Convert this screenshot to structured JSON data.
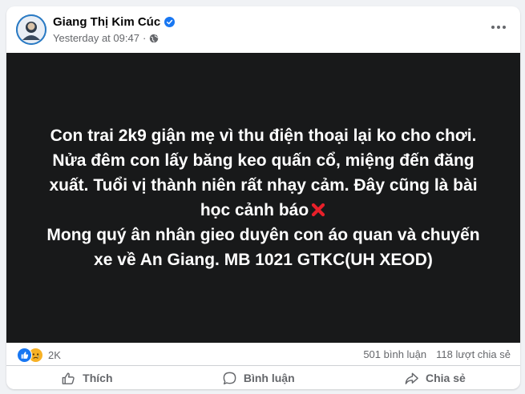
{
  "post": {
    "author": "Giang Thị Kim Cúc",
    "timestamp": "Yesterday at 09:47",
    "separator": "·",
    "privacy_icon": "globe-icon",
    "verified_icon": "verified-badge-icon",
    "more_icon": "more-options-icon"
  },
  "content": {
    "lines": [
      "Con trai 2k9 giận mẹ vì thu điện thoại lại ko cho chơi.",
      "Nửa đêm con lấy băng keo quấn cổ, miệng đến đăng",
      "xuất. Tuổi vị thành niên rất nhạy cảm. Đây cũng là bài",
      "học cảnh báo",
      "Mong quý ân nhân gieo duyên con áo quan và chuyến",
      "xe về An Giang. MB 1021 GTKC(UH XEOD)"
    ],
    "emoji": "cross-mark-emoji",
    "background_color": "#18191a",
    "text_color": "#ffffff"
  },
  "stats": {
    "reaction_count": "2K",
    "comments": "501 bình luận",
    "shares": "118 lượt chia sẻ",
    "reaction_icons": [
      "like-reaction-icon",
      "sad-reaction-icon"
    ]
  },
  "actions": {
    "like": "Thích",
    "comment": "Bình luận",
    "share": "Chia sẻ"
  },
  "colors": {
    "accent": "#1877f2",
    "secondary_text": "#65676b",
    "page_bg": "#f0f2f5"
  }
}
